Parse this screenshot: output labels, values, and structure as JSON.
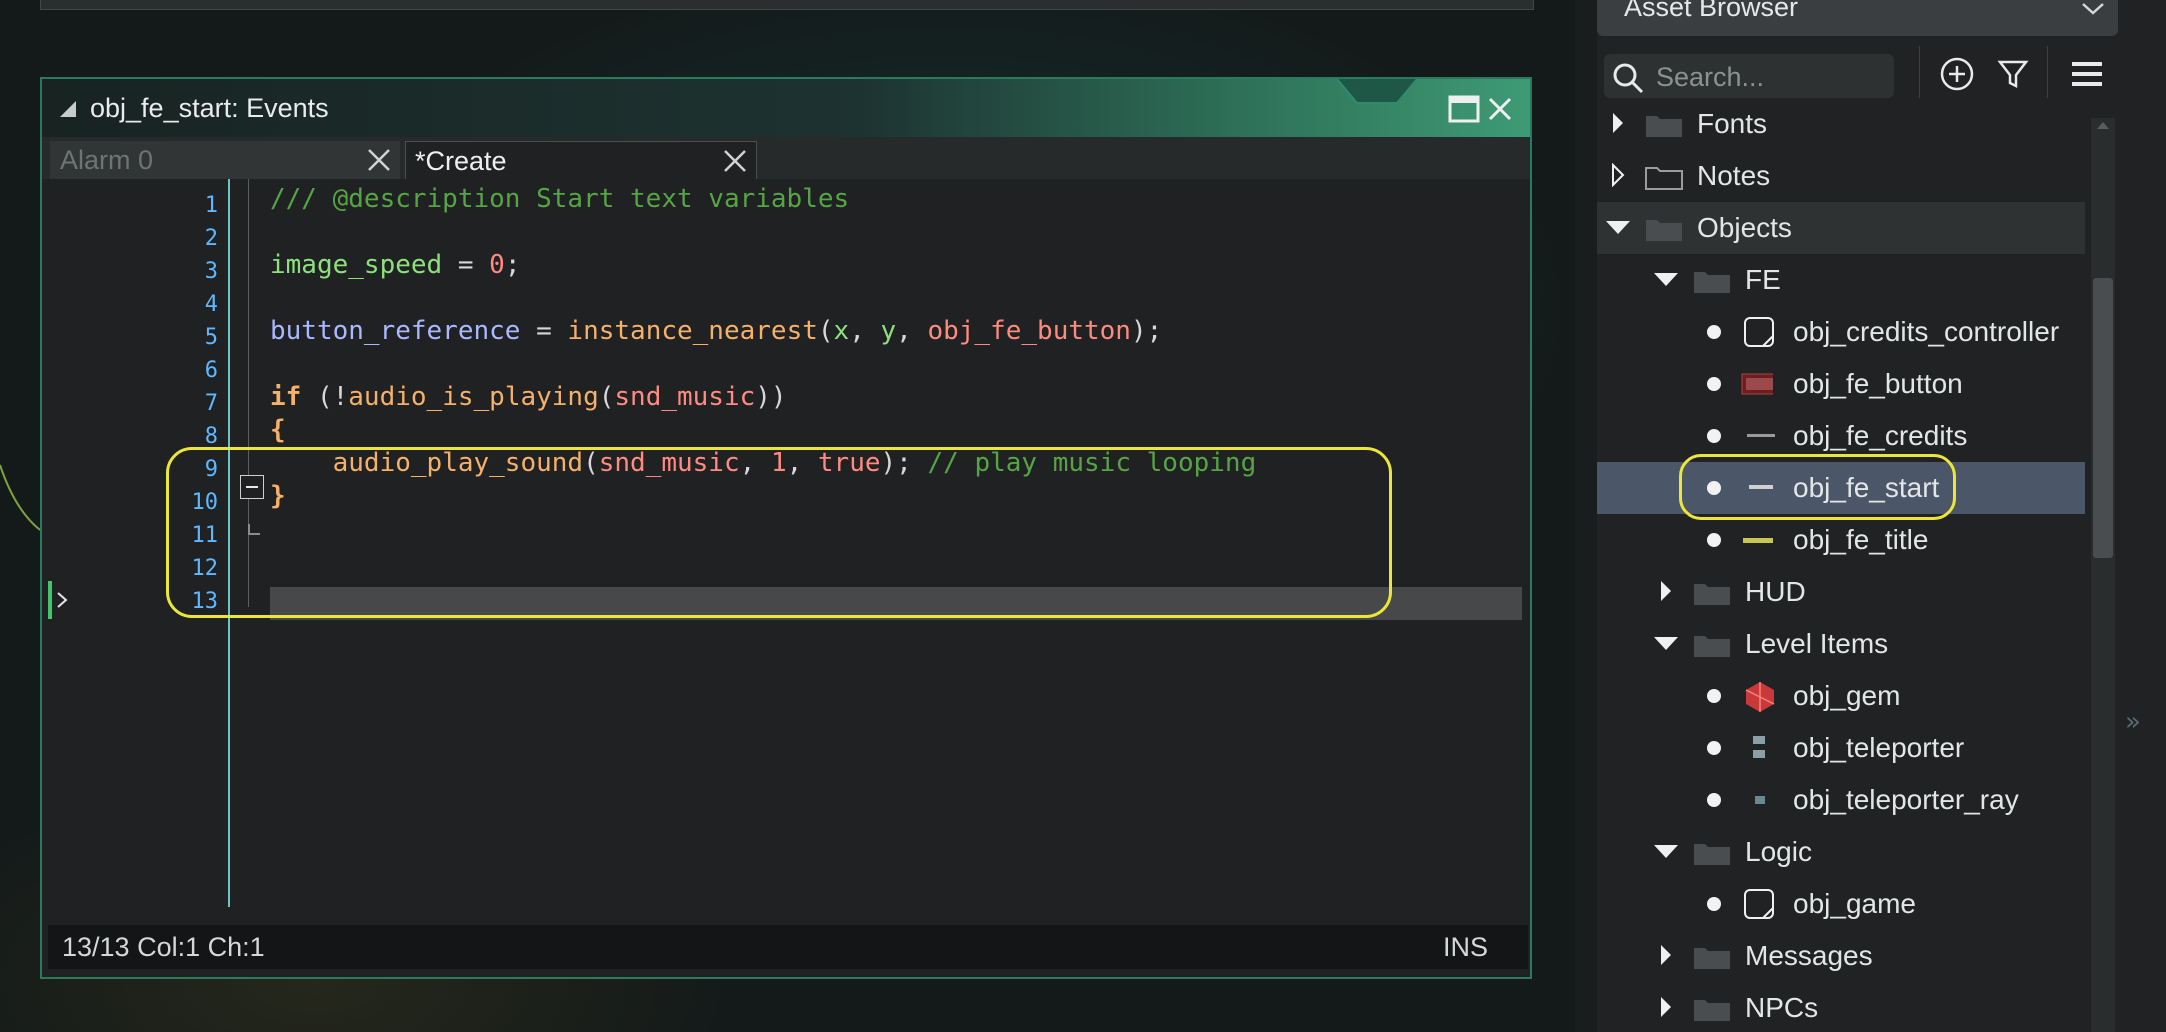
{
  "editor": {
    "title": "obj_fe_start: Events",
    "tabs": [
      {
        "label": "Alarm 0",
        "active": false
      },
      {
        "label": "*Create",
        "active": true
      }
    ],
    "line_numbers": [
      "1",
      "2",
      "3",
      "4",
      "5",
      "6",
      "7",
      "8",
      "9",
      "10",
      "11",
      "12",
      "13"
    ],
    "code": {
      "l1": "/// @description Start text variables",
      "l3_var": "image_speed",
      "l3_eq": " = ",
      "l3_num": "0",
      "l3_end": ";",
      "l5_var": "button_reference",
      "l5_eq": " = ",
      "l5_fn": "instance_nearest",
      "l5_open": "(",
      "l5_x": "x",
      "l5_comma1": ", ",
      "l5_y": "y",
      "l5_comma2": ", ",
      "l5_obj": "obj_fe_button",
      "l5_end": ");",
      "l7_kw": "if",
      "l7_open": " (!",
      "l7_fn": "audio_is_playing",
      "l7_p": "(",
      "l7_arg": "snd_music",
      "l7_close": "))",
      "l8": "{",
      "l9_indent": "    ",
      "l9_fn": "audio_play_sound",
      "l9_open": "(",
      "l9_arg": "snd_music",
      "l9_c1": ", ",
      "l9_num": "1",
      "l9_c2": ", ",
      "l9_true": "true",
      "l9_end": "); ",
      "l9_comment": "// play music looping",
      "l10": "}"
    },
    "status": {
      "position": "13/13 Col:1 Ch:1",
      "mode": "INS"
    }
  },
  "asset_browser": {
    "title": "Asset Browser",
    "search_placeholder": "Search...",
    "tree": {
      "fonts": "Fonts",
      "notes": "Notes",
      "objects": "Objects",
      "fe": "FE",
      "obj_credits_controller": "obj_credits_controller",
      "obj_fe_button": "obj_fe_button",
      "obj_fe_credits": "obj_fe_credits",
      "obj_fe_start": "obj_fe_start",
      "obj_fe_title": "obj_fe_title",
      "hud": "HUD",
      "level_items": "Level Items",
      "obj_gem": "obj_gem",
      "obj_teleporter": "obj_teleporter",
      "obj_teleporter_ray": "obj_teleporter_ray",
      "logic": "Logic",
      "obj_game": "obj_game",
      "messages": "Messages",
      "npcs": "NPCs"
    },
    "selected": "obj_fe_start"
  },
  "colors": {
    "highlight": "#ece63a",
    "selected_row": "#4b5768",
    "line_number": "#5fb8ff",
    "comment": "#56a545"
  }
}
